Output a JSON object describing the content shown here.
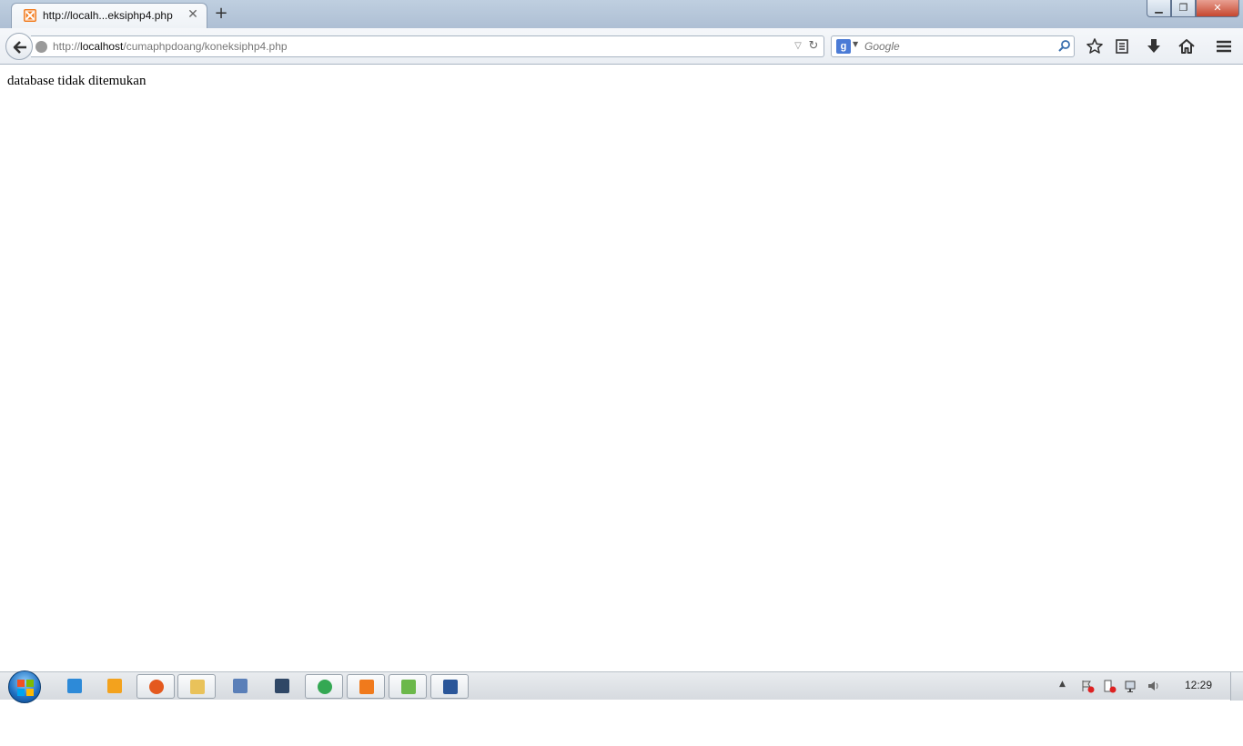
{
  "tab": {
    "title": "http://localh...eksiphp4.php",
    "close_glyph": "✕",
    "new_tab_glyph": "+"
  },
  "window_controls": {
    "minimize_glyph": "▁",
    "maximize_glyph": "❐",
    "close_glyph": "✕"
  },
  "navbar": {
    "url_scheme": "http://",
    "url_host": "localhost",
    "url_path": "/cumaphpdoang/koneksiphp4.php",
    "dropdown_glyph": "▽",
    "reload_glyph": "↻",
    "search_engine_badge": "g",
    "search_dropdown_glyph": "▼",
    "search_placeholder": "Google"
  },
  "page": {
    "message": "database tidak ditemukan"
  },
  "taskbar": {
    "tray_arrow_glyph": "▲",
    "clock": "12:29",
    "apps": [
      {
        "name": "internet-explorer-icon",
        "color": "#2d8ad8",
        "active": false
      },
      {
        "name": "media-player-icon",
        "color": "#f3a21d",
        "active": false
      },
      {
        "name": "firefox-icon",
        "color": "#e4591e",
        "active": true
      },
      {
        "name": "file-explorer-icon",
        "color": "#e9c25a",
        "active": true
      },
      {
        "name": "document-viewer-icon",
        "color": "#5a7fb8",
        "active": false
      },
      {
        "name": "sublime-app-icon",
        "color": "#2f4766",
        "active": false
      },
      {
        "name": "chrome-icon",
        "color": "#34a853",
        "active": true
      },
      {
        "name": "xampp-icon",
        "color": "#f07a1c",
        "active": true
      },
      {
        "name": "notepad-icon",
        "color": "#6bb84a",
        "active": true
      },
      {
        "name": "word-icon",
        "color": "#2a5699",
        "active": true
      }
    ]
  },
  "colors": {
    "accent_blue": "#2a6ebd",
    "xampp_orange": "#f07a1c"
  }
}
